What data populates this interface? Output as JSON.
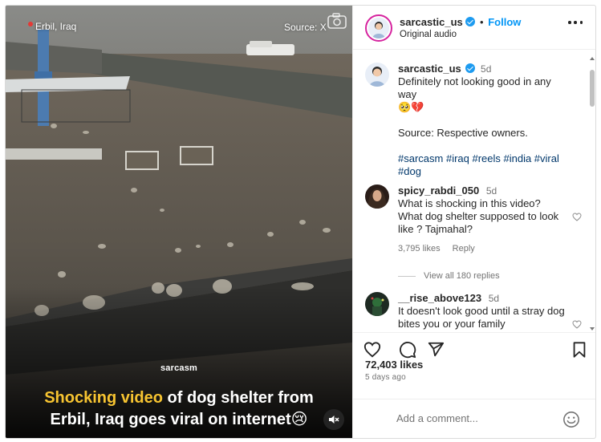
{
  "video": {
    "location": "Erbil, Iraq",
    "source": "Source: X",
    "brand": "sarcasm",
    "caption_highlight": "Shocking video",
    "caption_rest_1": " of dog shelter from",
    "caption_line2": "Erbil, Iraq goes viral on internet",
    "caption_emoji": "😢"
  },
  "header": {
    "username": "sarcastic_us",
    "separator": "•",
    "follow_label": "Follow",
    "audio": "Original audio"
  },
  "post": {
    "username": "sarcastic_us",
    "time": "5d",
    "text": "Definitely not looking good in any way",
    "emoji": "🥺💔",
    "source_line": "Source: Respective owners.",
    "hashtags": "#sarcasm #iraq #reels #india #viral #dog"
  },
  "comments": [
    {
      "username": "spicy_rabdi_050",
      "time": "5d",
      "text": "What is shocking in this video? What dog shelter supposed to look like ? Tajmahal?",
      "likes": "3,795 likes",
      "reply_label": "Reply",
      "view_replies": "View all 180 replies"
    },
    {
      "username": "__rise_above123",
      "time": "5d",
      "text": "It doesn't look good until a stray dog bites you or your family"
    }
  ],
  "likes": "72,403 likes",
  "posted_ago": "5 days ago",
  "add_comment_placeholder": "Add a comment...",
  "colors": {
    "follow": "#0095f6",
    "hashtag": "#00376b",
    "caption_highlight": "#f7c431",
    "verified": "#1d9bf0"
  },
  "icons": [
    "camera-icon",
    "mute-icon",
    "more-icon",
    "heart-icon",
    "comment-icon",
    "share-icon",
    "bookmark-icon",
    "emoji-icon",
    "verified-icon",
    "location-pin-icon"
  ]
}
